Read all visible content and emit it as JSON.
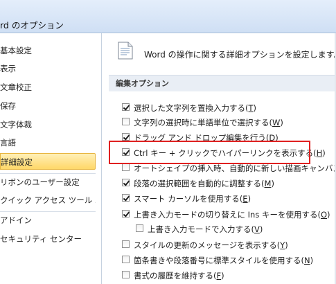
{
  "window": {
    "title": "rd のオプション"
  },
  "sidebar": {
    "items": [
      {
        "label": "基本設定"
      },
      {
        "label": "表示"
      },
      {
        "label": "文章校正"
      },
      {
        "label": "保存"
      },
      {
        "label": "文字体裁"
      },
      {
        "label": "言語"
      },
      {
        "label": "詳細設定",
        "selected": true
      },
      {
        "label": "リボンのユーザー設定"
      },
      {
        "label": "クイック アクセス ツール バー"
      },
      {
        "label": "アドイン"
      },
      {
        "label": "セキュリティ センター"
      }
    ]
  },
  "main": {
    "header": "Word の操作に関する詳細オプションを設定します。",
    "section_title": "編集オプション",
    "options": [
      {
        "pre": "選択した文字列を置換入力する(",
        "key": "T",
        "post": ")",
        "checked": true
      },
      {
        "pre": "文字列の選択時に単語単位で選択する(",
        "key": "W",
        "post": ")",
        "checked": false
      },
      {
        "pre": "ドラッグ アンド ドロップ編集を行う(",
        "key": "D",
        "post": ")",
        "checked": true
      },
      {
        "pre": "Ctrl キー + クリックでハイパーリンクを表示する(",
        "key": "H",
        "post": ")",
        "checked": true
      },
      {
        "pre": "オートシェイプの挿入時、自動的に新しい描画キャンバスを作成",
        "key": "",
        "post": "",
        "checked": false
      },
      {
        "pre": "段落の選択範囲を自動的に調整する(",
        "key": "M",
        "post": ")",
        "checked": true
      },
      {
        "pre": "スマート カーソルを使用する(",
        "key": "E",
        "post": ")",
        "checked": true
      },
      {
        "pre": "上書き入力モードの切り替えに Ins キーを使用する(",
        "key": "O",
        "post": ")",
        "checked": true
      },
      {
        "pre": "上書き入力モードで入力する(",
        "key": "V",
        "post": ")",
        "checked": false
      },
      {
        "pre": "スタイルの更新のメッセージを表示する(",
        "key": "Y",
        "post": ")",
        "checked": false
      },
      {
        "pre": "箇条書きや段落番号に標準スタイルを使用する(",
        "key": "N",
        "post": ")",
        "checked": false
      },
      {
        "pre": "書式の履歴を維持する(",
        "key": "F",
        "post": ")",
        "checked": false
      }
    ]
  }
}
